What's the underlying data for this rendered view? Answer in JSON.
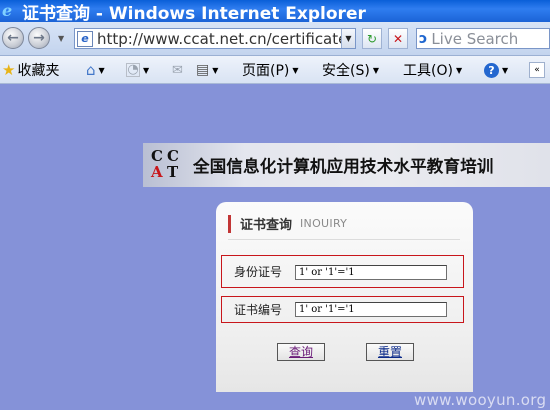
{
  "window": {
    "title": "证书查询 - Windows Internet Explorer"
  },
  "addressbar": {
    "url": "http://www.ccat.net.cn/certificates",
    "search_placeholder": "Live Search"
  },
  "commandbar": {
    "favorites_label": "收藏夹",
    "page_menu": "页面(P)",
    "safety_menu": "安全(S)",
    "tools_menu": "工具(O)"
  },
  "banner": {
    "logo_letters": [
      "C",
      "C",
      "A",
      "T"
    ],
    "title": "全国信息化计算机应用技术水平教育培训"
  },
  "panel": {
    "title": "证书查询",
    "subtitle": "INOUIRY",
    "fields": [
      {
        "label": "身份证号",
        "value": "1' or '1'='1"
      },
      {
        "label": "证书编号",
        "value": "1' or '1'='1"
      }
    ],
    "query_button": "查询",
    "reset_button": "重置"
  },
  "watermark": "www.wooyun.org",
  "colors": {
    "page_background": "#8592d8",
    "highlight_border": "#c8161b",
    "titlebar": "#1b63d6"
  }
}
